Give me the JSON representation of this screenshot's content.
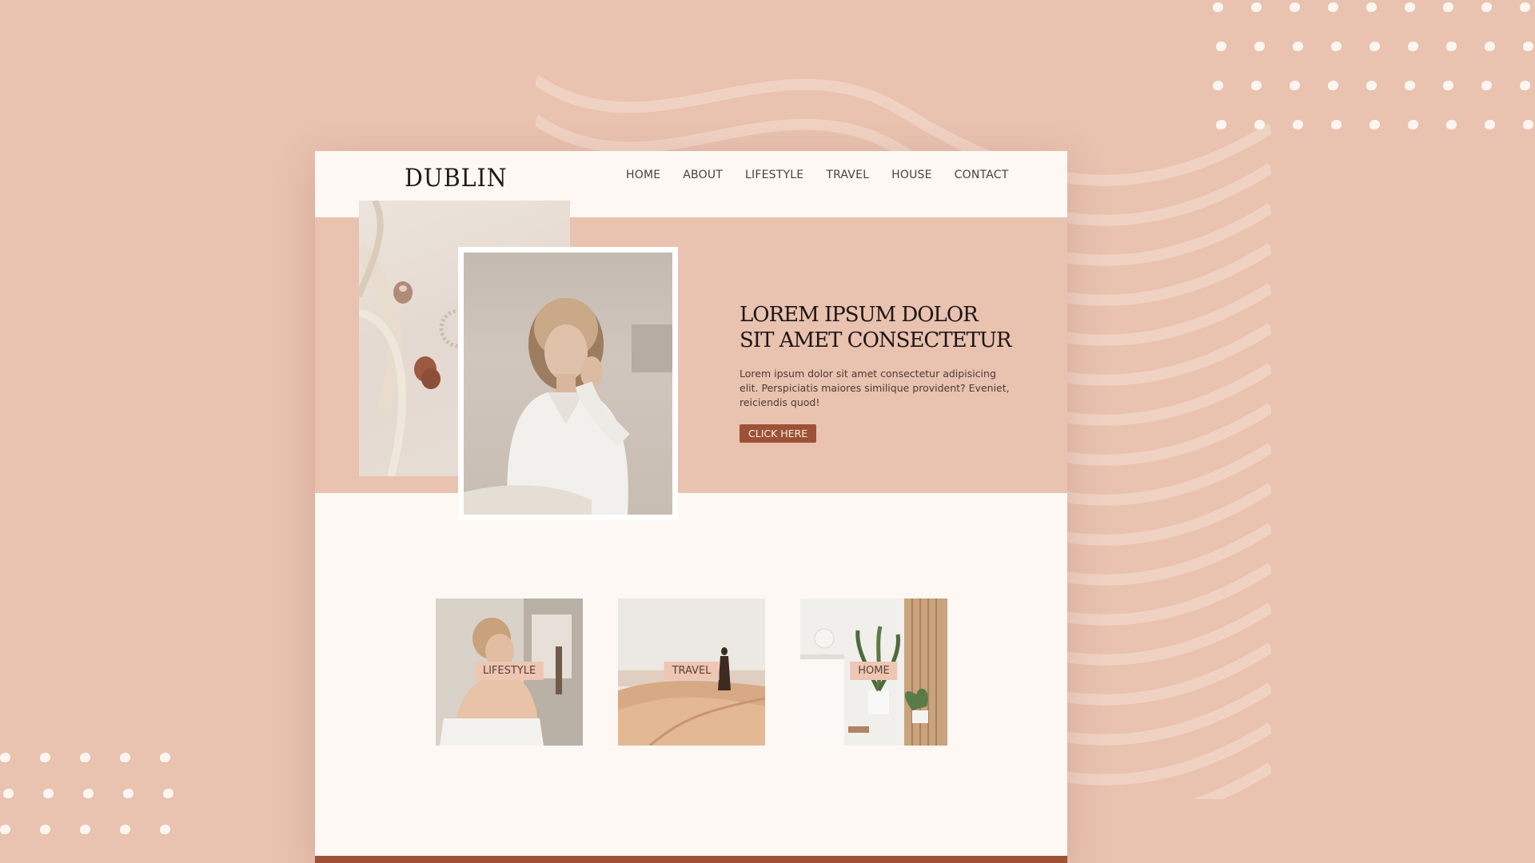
{
  "site": {
    "logo": "DUBLIN",
    "nav": [
      "HOME",
      "ABOUT",
      "LIFESTYLE",
      "TRAVEL",
      "HOUSE",
      "CONTACT"
    ]
  },
  "hero": {
    "title": "LOREM IPSUM DOLOR SIT AMET CONSECTETUR",
    "text": "Lorem ipsum dolor sit amet consectetur adipisicing elit. Perspiciatis maiores similique provident? Eveniet, reiciendis quod!",
    "cta_label": "CLICK HERE"
  },
  "categories": [
    {
      "label": "LIFESTYLE"
    },
    {
      "label": "TRAVEL"
    },
    {
      "label": "HOME"
    }
  ],
  "colors": {
    "background": "#e9c2b0",
    "page": "#fdf8f3",
    "accent": "#9d5136",
    "label_bg": "#eec6b3"
  }
}
